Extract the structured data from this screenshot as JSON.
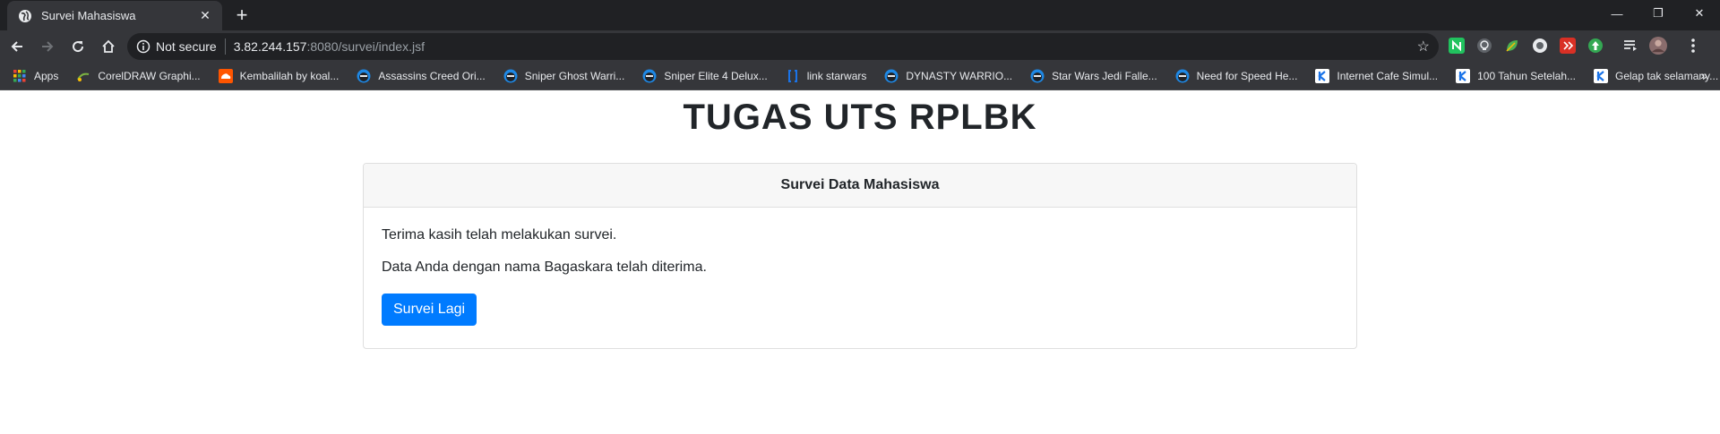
{
  "browser": {
    "tab": {
      "title": "Survei Mahasiswa",
      "close": "✕"
    },
    "new_tab": "+",
    "window_controls": {
      "minimize": "—",
      "restore": "❐",
      "close": "✕"
    },
    "omnibox": {
      "security_label": "Not secure",
      "host": "3.82.244.157",
      "path": ":8080/survei/index.jsf"
    },
    "extensions": [
      {
        "name": "n-extension-icon",
        "color": "#21c25e"
      },
      {
        "name": "bulb-extension-icon",
        "color": "#9aa0a6"
      },
      {
        "name": "leaf-extension-icon",
        "color": "#4caf50"
      },
      {
        "name": "disc-extension-icon",
        "color": "#e8eaed"
      },
      {
        "name": "red-extension-icon",
        "color": "#d93025"
      },
      {
        "name": "green-up-extension-icon",
        "color": "#34a853"
      },
      {
        "name": "playlist-icon",
        "color": "#e8eaed"
      },
      {
        "name": "avatar",
        "color": "#8a6d6d"
      }
    ],
    "bookmarks": [
      {
        "label": "Apps",
        "icon": "apps-grid-icon",
        "color": "#fbbc04"
      },
      {
        "label": "CorelDRAW Graphi...",
        "icon": "coreldraw-icon",
        "color": "#7cb342"
      },
      {
        "label": "Kembalilah by koal...",
        "icon": "soundcloud-icon",
        "color": "#ff5500"
      },
      {
        "label": "Assassins Creed Ori...",
        "icon": "ninja-icon",
        "color": "#1e88e5"
      },
      {
        "label": "Sniper Ghost Warri...",
        "icon": "ninja-icon",
        "color": "#1e88e5"
      },
      {
        "label": "Sniper Elite 4 Delux...",
        "icon": "ninja-icon",
        "color": "#1e88e5"
      },
      {
        "label": "link starwars",
        "icon": "bracket-icon",
        "color": "#1a73e8"
      },
      {
        "label": "DYNASTY WARRIO...",
        "icon": "ninja-icon",
        "color": "#1e88e5"
      },
      {
        "label": "Star Wars Jedi Falle...",
        "icon": "ninja-icon",
        "color": "#1e88e5"
      },
      {
        "label": "Need for Speed He...",
        "icon": "ninja-icon",
        "color": "#1e88e5"
      },
      {
        "label": "Internet Cafe Simul...",
        "icon": "k-icon",
        "color": "#1a73e8"
      },
      {
        "label": "100 Tahun Setelah...",
        "icon": "k-icon",
        "color": "#1a73e8"
      },
      {
        "label": "Gelap tak selamany...",
        "icon": "k-icon",
        "color": "#1a73e8"
      }
    ],
    "bookmarks_overflow": "»"
  },
  "page": {
    "heading": "TUGAS UTS RPLBK",
    "card": {
      "header": "Survei Data Mahasiswa",
      "message1": "Terima kasih telah melakukan survei.",
      "message2": "Data Anda dengan nama Bagaskara telah diterima.",
      "button": "Survei Lagi"
    },
    "accent_color": "#007bff"
  }
}
